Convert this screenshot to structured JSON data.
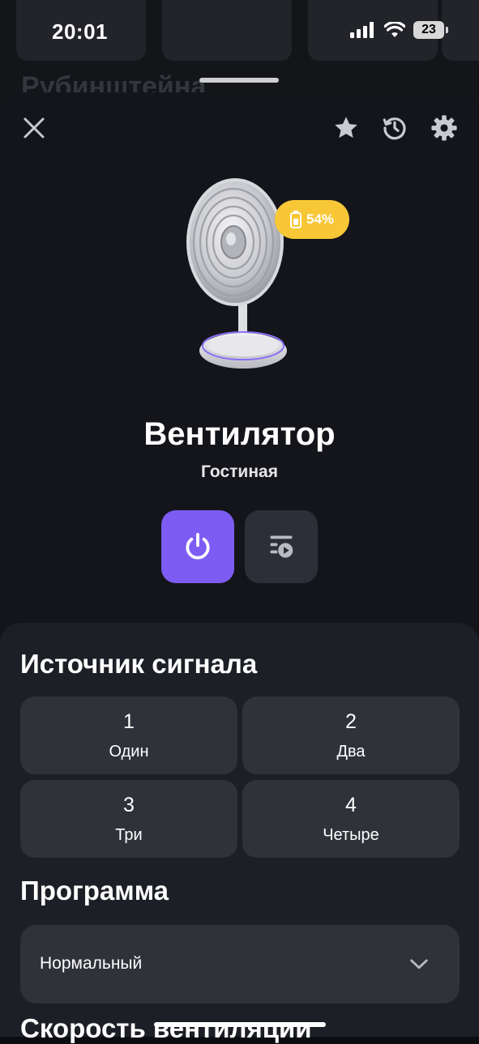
{
  "status_bar": {
    "time": "20:01",
    "battery": "23"
  },
  "background_app": {
    "cards": [
      "...",
      "...",
      "..."
    ],
    "title": "Рубинштейна"
  },
  "device": {
    "name": "Вентилятор",
    "room": "Гостиная",
    "battery_level": "54%",
    "battery_percent": 54
  },
  "toolbar": {
    "close_icon": "close-icon",
    "favorite_icon": "star-icon",
    "history_icon": "history-icon",
    "settings_icon": "gear-icon"
  },
  "actions": {
    "power_icon": "power-icon",
    "scenarios_icon": "scenarios-icon"
  },
  "signal_source": {
    "title": "Источник сигнала",
    "options": [
      {
        "number": "1",
        "label": "Один"
      },
      {
        "number": "2",
        "label": "Два"
      },
      {
        "number": "3",
        "label": "Три"
      },
      {
        "number": "4",
        "label": "Четыре"
      }
    ]
  },
  "program": {
    "title": "Программа",
    "selected": "Нормальный"
  },
  "fan_speed": {
    "title": "Скорость вентиляции"
  },
  "colors": {
    "accent": "#7d5cf3",
    "battery_badge": "#f7c736",
    "sheet_bg": "#14151b",
    "panel_bg": "#1d1f26",
    "tile_bg": "#30323a"
  }
}
